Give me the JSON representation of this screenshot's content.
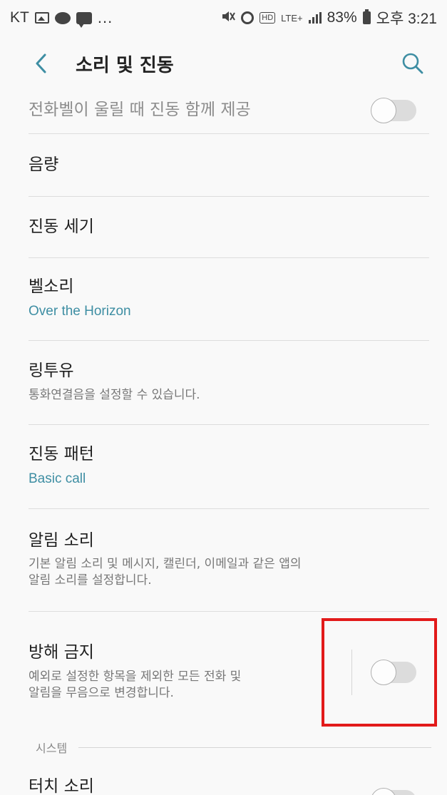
{
  "status_bar": {
    "carrier": "KT",
    "talk_icon_text": "TALK",
    "more": "...",
    "hd": "HD",
    "lte": "LTE+",
    "battery": "83%",
    "time": "오후 3:21"
  },
  "app_bar": {
    "title": "소리 및 진동"
  },
  "items": [
    {
      "title": "전화벨이 울릴 때 진동 함께 제공",
      "toggle_on": false
    },
    {
      "title": "음량"
    },
    {
      "title": "진동 세기"
    },
    {
      "title": "벨소리",
      "subtitle": "Over the Horizon"
    },
    {
      "title": "링투유",
      "subtitle": "통화연결음을 설정할 수 있습니다."
    },
    {
      "title": "진동 패턴",
      "subtitle": "Basic call"
    },
    {
      "title": "알림 소리",
      "subtitle_line1": "기본 알림 소리 및 메시지, 캘린더, 이메일과 같은 앱의",
      "subtitle_line2": "알림 소리를 설정합니다."
    },
    {
      "title": "방해 금지",
      "subtitle_line1": "예외로 설정한 항목을 제외한 모든 전화 및",
      "subtitle_line2": "알림을 무음으로 변경합니다.",
      "toggle_on": false
    }
  ],
  "section": {
    "label": "시스템"
  },
  "partial_item": {
    "title": "터치 소리",
    "toggle_on": false
  },
  "colors": {
    "accent_text": "#3e8ea3",
    "highlight": "#e21a1a",
    "toggle_off": "#dcdcdc"
  }
}
